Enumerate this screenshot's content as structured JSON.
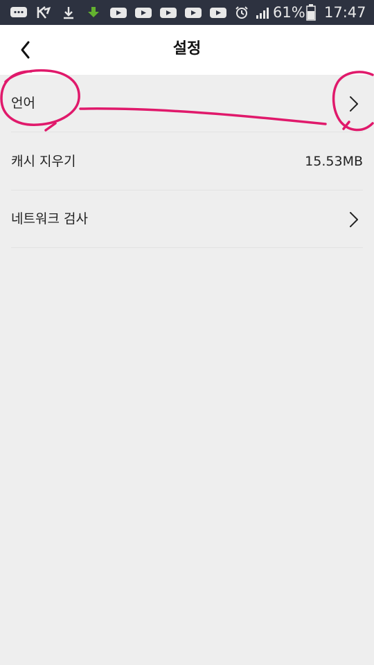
{
  "status_bar": {
    "battery_percent": "61%",
    "time": "17:47",
    "icons": [
      "chat-icon",
      "k-icon",
      "download-icon",
      "download-green-icon",
      "youtube-icon",
      "youtube-icon",
      "youtube-icon",
      "youtube-icon",
      "youtube-icon",
      "alarm-icon",
      "signal-icon",
      "battery-icon"
    ]
  },
  "header": {
    "title": "설정",
    "back_icon": "chevron-left-icon"
  },
  "settings": {
    "items": [
      {
        "label": "언어",
        "accessory": "chevron-right-icon"
      },
      {
        "label": "캐시 지우기",
        "value": "15.53MB"
      },
      {
        "label": "네트워크 검사",
        "accessory": "chevron-right-icon"
      }
    ]
  },
  "colors": {
    "status_bar_bg": "#2d3240",
    "header_bg": "#ffffff",
    "page_bg": "#eeeeee",
    "annotation": "#e0196b"
  }
}
